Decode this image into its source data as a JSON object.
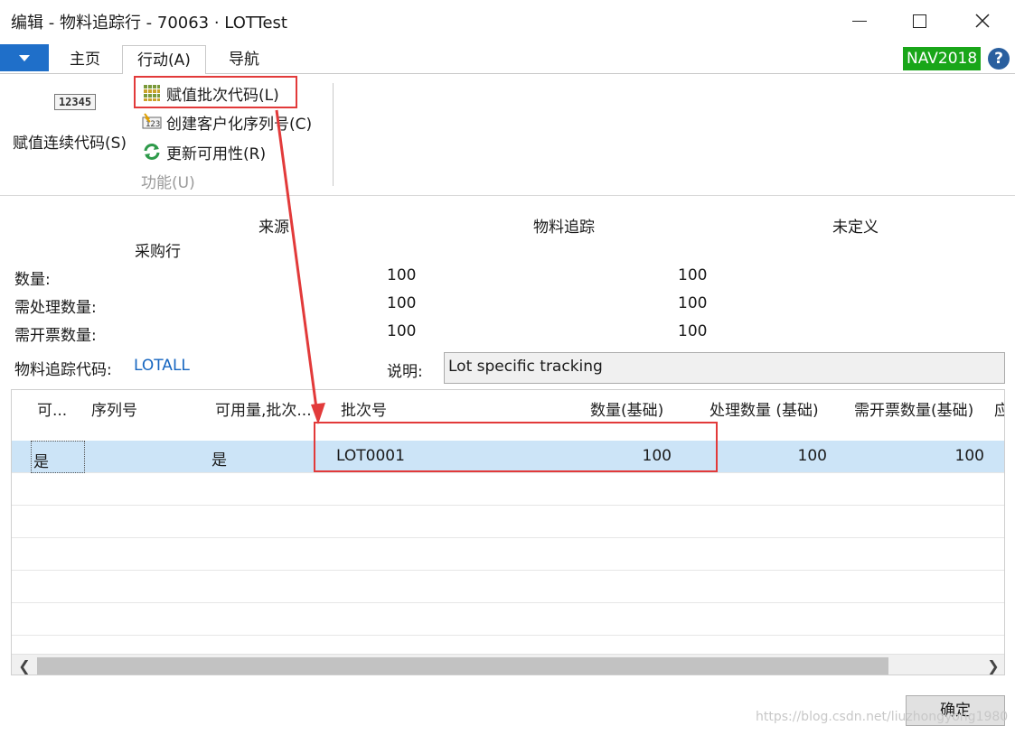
{
  "window": {
    "title": "编辑 - 物料追踪行 - 70063 · LOTTest"
  },
  "ribbon": {
    "tabs": [
      "主页",
      "行动(A)",
      "导航"
    ],
    "badge": "NAV2018",
    "help": "?",
    "big_button": {
      "icon_text": "12345",
      "label": "赋值连续代码(S)"
    },
    "small_buttons": [
      {
        "label": "赋值批次代码(L)",
        "icon": "grid-icon"
      },
      {
        "label": "创建客户化序列号(C)",
        "icon": "serial-number-icon"
      },
      {
        "label": "更新可用性(R)",
        "icon": "refresh-icon"
      }
    ],
    "group_label": "功能(U)"
  },
  "summary": {
    "columns": [
      "来源",
      "物料追踪",
      "未定义"
    ],
    "source_type": "采购行",
    "rows": [
      {
        "label": "数量:",
        "source": "100",
        "tracking": "100"
      },
      {
        "label": "需处理数量:",
        "source": "100",
        "tracking": "100"
      },
      {
        "label": "需开票数量:",
        "source": "100",
        "tracking": "100"
      }
    ],
    "tracking_code_label": "物料追踪代码:",
    "tracking_code": "LOTALL",
    "description_label": "说明:",
    "description": "Lot specific tracking"
  },
  "grid": {
    "headers": [
      "可...",
      "序列号",
      "可用量,批次...",
      "批次号",
      "数量(基础)",
      "处理数量 (基础)",
      "需开票数量(基础)",
      "应"
    ],
    "rows": [
      {
        "available": "是",
        "serial_no": "",
        "lot_available": "是",
        "lot_no": "LOT0001",
        "qty_base": "100",
        "qty_handle_base": "100",
        "qty_invoice_base": "100"
      }
    ]
  },
  "footer": {
    "ok_label": "确定",
    "watermark": "https://blog.csdn.net/liuzhongyong1980"
  },
  "colors": {
    "accent": "#1f6fc9",
    "badge": "#19a619",
    "selected_row": "#cce4f7",
    "annotation": "#e23a3a"
  }
}
